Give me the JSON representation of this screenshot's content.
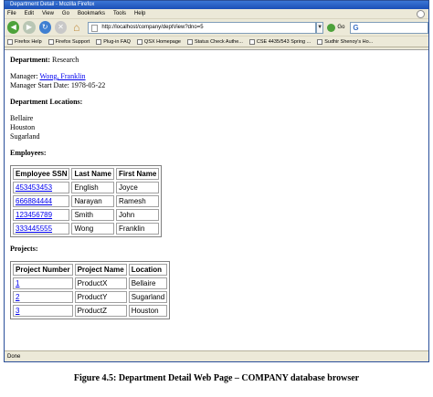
{
  "window": {
    "title": "Department Detail - Mozilla Firefox"
  },
  "menu": [
    "File",
    "Edit",
    "View",
    "Go",
    "Bookmarks",
    "Tools",
    "Help"
  ],
  "nav": {
    "url": "http://localhost/company/deptView?dno=5",
    "go_label": "Go",
    "search_text": "G"
  },
  "bookmarks": [
    "Firefox Help",
    "Firefox Support",
    "Plug-in FAQ",
    "QSX Homepage",
    "Status Check Authe...",
    "CSE 4435/543 Spring ...",
    "Sudhir Shenoy's Ho..."
  ],
  "page": {
    "department_label": "Department:",
    "department_value": "Research",
    "manager_label": "Manager:",
    "manager_value": "Wong, Franklin",
    "manager_start_label": "Manager Start Date:",
    "manager_start_value": "1978-05-22",
    "locations_heading": "Department Locations:",
    "locations": [
      "Bellaire",
      "Houston",
      "Sugarland"
    ],
    "employees_heading": "Employees:",
    "employees_headers": [
      "Employee SSN",
      "Last Name",
      "First Name"
    ],
    "employees": [
      [
        "453453453",
        "English",
        "Joyce"
      ],
      [
        "666884444",
        "Narayan",
        "Ramesh"
      ],
      [
        "123456789",
        "Smith",
        "John"
      ],
      [
        "333445555",
        "Wong",
        "Franklin"
      ]
    ],
    "projects_heading": "Projects:",
    "projects_headers": [
      "Project Number",
      "Project Name",
      "Location"
    ],
    "projects": [
      [
        "1",
        "ProductX",
        "Bellaire"
      ],
      [
        "2",
        "ProductY",
        "Sugarland"
      ],
      [
        "3",
        "ProductZ",
        "Houston"
      ]
    ]
  },
  "status": "Done",
  "caption": "Figure 4.5: Department Detail Web Page – COMPANY database browser"
}
